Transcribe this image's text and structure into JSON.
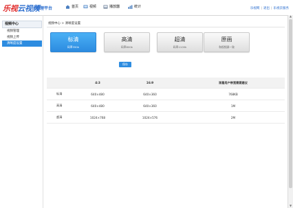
{
  "header": {
    "logo_red": "乐视",
    "logo_blue": "云视频",
    "platform": "管理平台",
    "nav": [
      {
        "label": "首页",
        "icon": "home-icon"
      },
      {
        "label": "视频",
        "icon": "video-icon"
      },
      {
        "label": "播放器",
        "icon": "player-icon"
      },
      {
        "label": "统计",
        "icon": "stats-icon"
      }
    ],
    "links": [
      "乐视网",
      "退出",
      "乐视云服务"
    ]
  },
  "sidebar": {
    "title": "视频中心",
    "items": [
      {
        "label": "视频管理"
      },
      {
        "label": "视频上传"
      },
      {
        "label": "清晰度设置"
      }
    ]
  },
  "breadcrumb": "视频中心 > 清晰度设置",
  "quality": [
    {
      "title": "标清",
      "sub": "码率350k"
    },
    {
      "title": "高清",
      "sub": "码率800k"
    },
    {
      "title": "超清",
      "sub": "码率1100k"
    },
    {
      "title": "原画",
      "sub": "和视频源一致"
    }
  ],
  "save_label": "保存",
  "table": {
    "headers": [
      "",
      "4:3",
      "16:9",
      "观看用户带宽需要建议"
    ],
    "rows": [
      [
        "标清",
        "640×480",
        "640×360",
        "768KB"
      ],
      [
        "高清",
        "640×480",
        "640×360",
        "1M"
      ],
      [
        "超清",
        "1024×768",
        "1024×576",
        "2M"
      ]
    ]
  },
  "colors": {
    "accent": "#2d8ce0",
    "logo_red": "#e02a2a",
    "logo_blue": "#2d6fcf"
  }
}
